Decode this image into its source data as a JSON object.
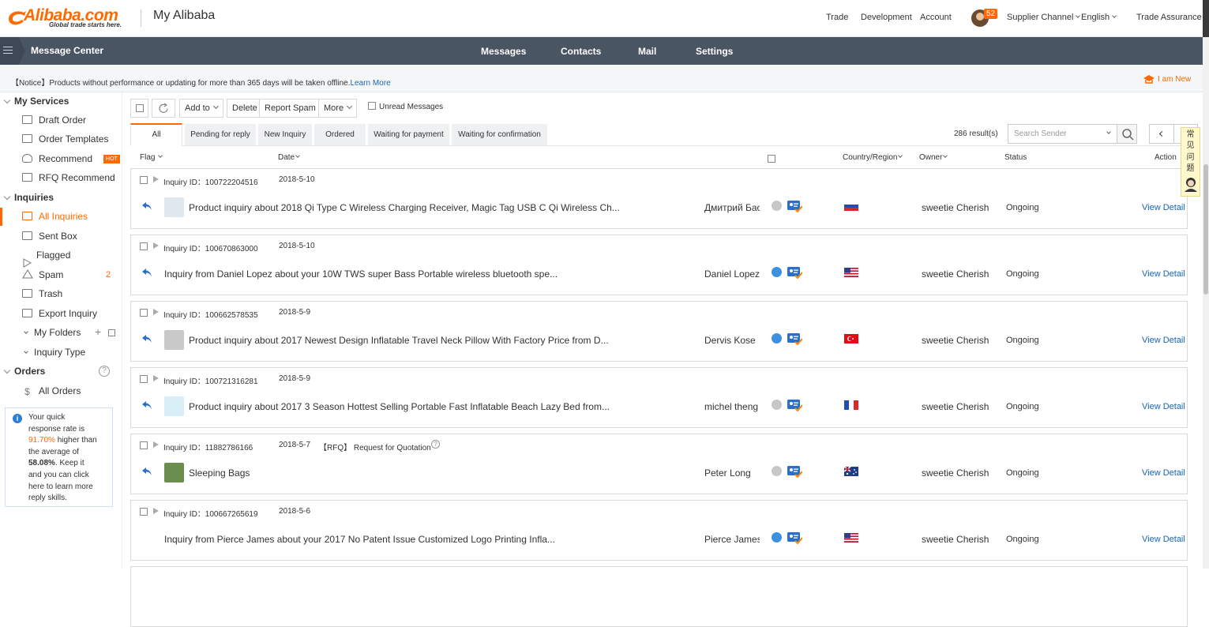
{
  "header": {
    "logo": "Alibaba.com",
    "logo_tagline": "Global trade starts here.",
    "title": "My Alibaba",
    "nav": [
      "Trade",
      "Development",
      "Account"
    ],
    "badge_count": "52",
    "supplier_channel": "Supplier Channel",
    "language": "English",
    "trade_assurance": "Trade Assurance"
  },
  "navbar": {
    "section": "Message Center",
    "tabs": [
      "Messages",
      "Contacts",
      "Mail",
      "Settings"
    ]
  },
  "notice": {
    "text": "【Notice】Products without performance or updating for more than 365 days will be taken offline.",
    "link": "Learn More",
    "new_user": "I am New"
  },
  "sidebar": {
    "my_services": "My Services",
    "services": [
      "Draft Order",
      "Order Templates",
      "Recommend",
      "RFQ Recommend"
    ],
    "hot": "HOT",
    "inquiries": "Inquiries",
    "inquiry_items": [
      "All Inquiries",
      "Sent Box",
      "Flagged",
      "Spam",
      "Trash",
      "Export Inquiry"
    ],
    "spam_count": "2",
    "my_folders": "My Folders",
    "inquiry_type": "Inquiry Type",
    "orders": "Orders",
    "orders_help": "?",
    "all_orders": "All Orders",
    "rate": {
      "t1": "Your quick response rate is",
      "v1": "91.70%",
      "t2": "higher than the average of",
      "v2": "58.08%",
      "t3": ". Keep it and you can click here to learn more reply skills."
    }
  },
  "toolbar": {
    "add_to": "Add to",
    "delete": "Delete",
    "report_spam": "Report Spam",
    "more": "More",
    "unread": "Unread Messages"
  },
  "tabs": [
    "All",
    "Pending for reply",
    "New Inquiry",
    "Ordered",
    "Waiting for payment",
    "Waiting for confirmation"
  ],
  "results": "286 result(s)",
  "search_placeholder": "Search Sender",
  "columns": {
    "flag": "Flag",
    "date": "Date",
    "country": "Country/Region",
    "owner": "Owner",
    "status": "Status",
    "action": "Action"
  },
  "rows": [
    {
      "id": "Inquiry ID：100722204516",
      "date": "2018-5-10",
      "rfq": "",
      "subject": "Product inquiry about 2018 Qi Type C Wireless Charging Receiver, Magic Tag USB C Qi Wireless Ch...",
      "sender": "Дмитрий Басов",
      "owner": "sweetie Cherish",
      "status": "Ongoing",
      "action": "View Detail",
      "country": "ru",
      "has_thumb": true,
      "dot": "grey"
    },
    {
      "id": "Inquiry ID：100670863000",
      "date": "2018-5-10",
      "rfq": "",
      "subject": "Inquiry from Daniel Lopez about your 10W TWS super Bass Portable wireless bluetooth spe...",
      "sender": "Daniel Lopez",
      "owner": "sweetie Cherish",
      "status": "Ongoing",
      "action": "View Detail",
      "country": "us",
      "has_thumb": false,
      "dot": "blue"
    },
    {
      "id": "Inquiry ID：100662578535",
      "date": "2018-5-9",
      "rfq": "",
      "subject": "Product inquiry about 2017 Newest Design Inflatable Travel Neck Pillow With Factory Price from D...",
      "sender": "Dervis Kose",
      "owner": "sweetie Cherish",
      "status": "Ongoing",
      "action": "View Detail",
      "country": "tr",
      "has_thumb": true,
      "dot": "blue"
    },
    {
      "id": "Inquiry ID：100721316281",
      "date": "2018-5-9",
      "rfq": "",
      "subject": "Product inquiry about 2017 3 Season Hottest Selling Portable Fast Inflatable Beach Lazy Bed from...",
      "sender": "michel theng",
      "owner": "sweetie Cherish",
      "status": "Ongoing",
      "action": "View Detail",
      "country": "fr",
      "has_thumb": true,
      "dot": "grey"
    },
    {
      "id": "Inquiry ID：11882786166",
      "date": "2018-5-7",
      "rfq": "【RFQ】 Request for Quotation",
      "subject": "Sleeping Bags",
      "sender": "Peter Long",
      "owner": "sweetie Cherish",
      "status": "Ongoing",
      "action": "View Detail",
      "country": "au",
      "has_thumb": true,
      "dot": "grey"
    },
    {
      "id": "Inquiry ID：100667265619",
      "date": "2018-5-6",
      "rfq": "",
      "subject": "Inquiry from Pierce James about your 2017 No Patent Issue Customized Logo Printing Infla...",
      "sender": "Pierce James",
      "owner": "sweetie Cherish",
      "status": "Ongoing",
      "action": "View Detail",
      "country": "us",
      "has_thumb": false,
      "dot": "blue"
    }
  ],
  "float_panel": [
    "常",
    "见",
    "问",
    "题"
  ],
  "colors": {
    "accent": "#ff6a00",
    "link": "#1a65b8",
    "navbar": "#4a5563"
  }
}
